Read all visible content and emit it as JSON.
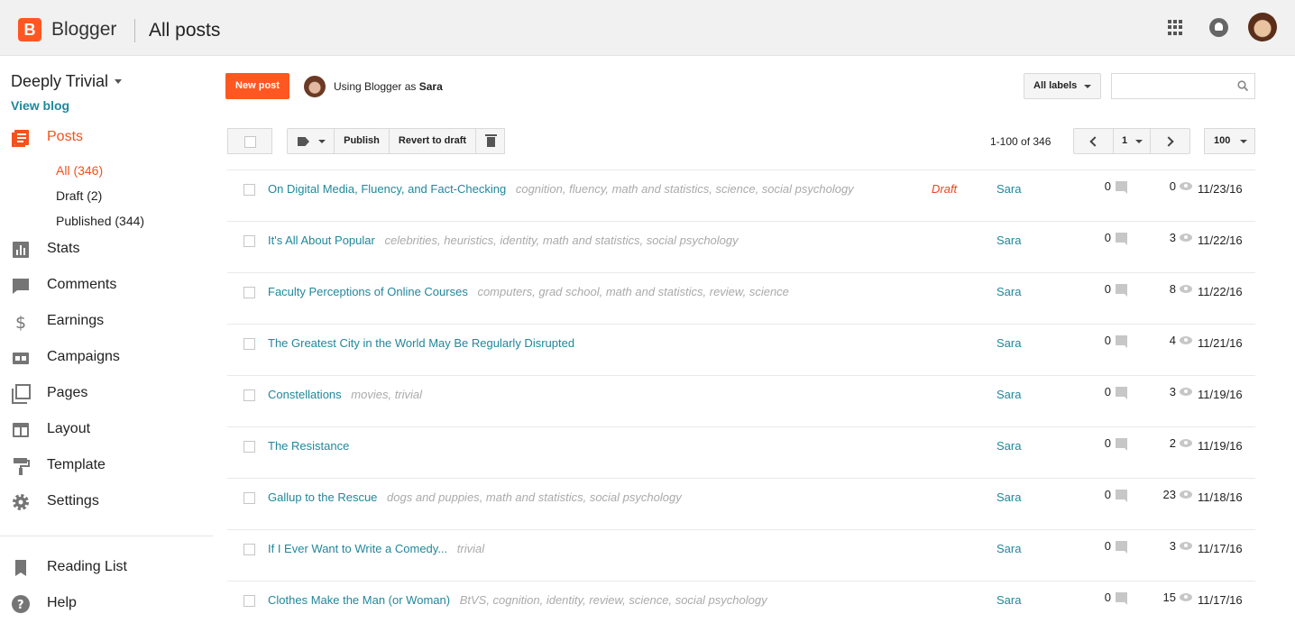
{
  "header": {
    "logo_letter": "B",
    "brand": "Blogger",
    "page_title": "All posts",
    "brand_color": "#ff5722"
  },
  "sidebar": {
    "blog_name": "Deeply Trivial",
    "view_blog": "View blog",
    "nav": [
      {
        "label": "Posts",
        "icon": "posts-icon"
      },
      {
        "label": "Stats",
        "icon": "stats-icon"
      },
      {
        "label": "Comments",
        "icon": "comments-icon"
      },
      {
        "label": "Earnings",
        "icon": "dollar-icon"
      },
      {
        "label": "Campaigns",
        "icon": "ad-icon"
      },
      {
        "label": "Pages",
        "icon": "pages-icon"
      },
      {
        "label": "Layout",
        "icon": "layout-icon"
      },
      {
        "label": "Template",
        "icon": "paint-roller-icon"
      },
      {
        "label": "Settings",
        "icon": "gear-icon"
      },
      {
        "label": "Reading List",
        "icon": "bookmark-icon"
      },
      {
        "label": "Help",
        "icon": "help-icon"
      }
    ],
    "posts_sub": [
      {
        "label": "All (346)"
      },
      {
        "label": "Draft (2)"
      },
      {
        "label": "Published (344)"
      }
    ]
  },
  "main": {
    "new_post": "New post",
    "using_prefix": "Using Blogger as ",
    "using_user": "Sara",
    "all_labels": "All labels",
    "search_value": "",
    "toolbar": {
      "publish": "Publish",
      "revert": "Revert to draft"
    },
    "range": "1-100 of 346",
    "page": "1",
    "per_page": "100"
  },
  "posts": [
    {
      "title": "On Digital Media, Fluency, and Fact-Checking",
      "labels": [
        "cognition",
        "fluency",
        "math and statistics",
        "science",
        "social psychology"
      ],
      "status": "Draft",
      "author": "Sara",
      "comments": "0",
      "views": "0",
      "date": "11/23/16"
    },
    {
      "title": "It's All About Popular",
      "labels": [
        "celebrities",
        "heuristics",
        "identity",
        "math and statistics",
        "social psychology"
      ],
      "status": "",
      "author": "Sara",
      "comments": "0",
      "views": "3",
      "date": "11/22/16"
    },
    {
      "title": "Faculty Perceptions of Online Courses",
      "labels": [
        "computers",
        "grad school",
        "math and statistics",
        "review",
        "science"
      ],
      "status": "",
      "author": "Sara",
      "comments": "0",
      "views": "8",
      "date": "11/22/16"
    },
    {
      "title": "The Greatest City in the World May Be Regularly Disrupted",
      "labels": [],
      "status": "",
      "author": "Sara",
      "comments": "0",
      "views": "4",
      "date": "11/21/16"
    },
    {
      "title": "Constellations",
      "labels": [
        "movies",
        "trivial"
      ],
      "status": "",
      "author": "Sara",
      "comments": "0",
      "views": "3",
      "date": "11/19/16"
    },
    {
      "title": "The Resistance",
      "labels": [],
      "status": "",
      "author": "Sara",
      "comments": "0",
      "views": "2",
      "date": "11/19/16"
    },
    {
      "title": "Gallup to the Rescue",
      "labels": [
        "dogs and puppies",
        "math and statistics",
        "social psychology"
      ],
      "status": "",
      "author": "Sara",
      "comments": "0",
      "views": "23",
      "date": "11/18/16"
    },
    {
      "title": "If I Ever Want to Write a Comedy...",
      "labels": [
        "trivial"
      ],
      "status": "",
      "author": "Sara",
      "comments": "0",
      "views": "3",
      "date": "11/17/16"
    },
    {
      "title": "Clothes Make the Man (or Woman)",
      "labels": [
        "BtVS",
        "cognition",
        "identity",
        "review",
        "science",
        "social psychology"
      ],
      "status": "",
      "author": "Sara",
      "comments": "0",
      "views": "15",
      "date": "11/17/16"
    }
  ]
}
